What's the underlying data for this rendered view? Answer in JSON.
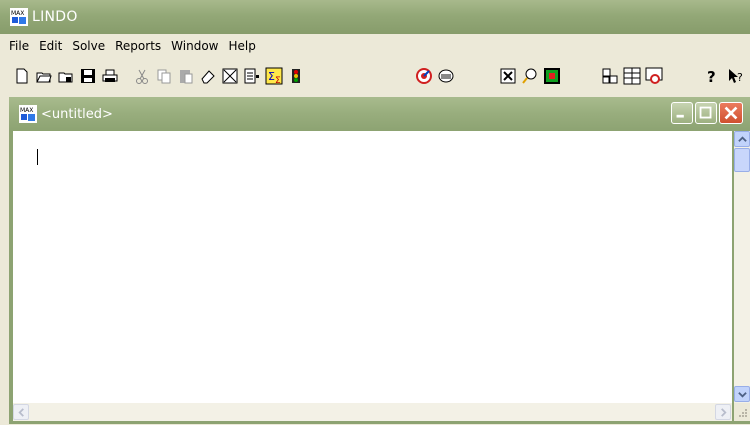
{
  "app": {
    "title": "LINDO",
    "icon": "lindo-max-icon"
  },
  "menu": {
    "items": [
      "File",
      "Edit",
      "Solve",
      "Reports",
      "Window",
      "Help"
    ]
  },
  "toolbar": {
    "buttons": [
      "new-icon",
      "open-icon",
      "view-icon",
      "save-icon",
      "print-icon",
      "cut-icon",
      "copy-icon",
      "paste-icon",
      "clear-icon",
      "clear-all-icon",
      "paste-symbol-icon",
      "solve-icon",
      "compile-icon",
      "options-icon",
      "send-to-back-icon",
      "close-all-icon",
      "look-icon",
      "picture-icon",
      "tile-icon",
      "cascade-icon",
      "basis-picture-icon",
      "help-icon",
      "context-help-icon"
    ]
  },
  "document": {
    "title": "<untitled>",
    "content": ""
  },
  "colors": {
    "titlebar": "#93A877",
    "close": "#D0502F",
    "scrollbar": "#C1D3FB"
  }
}
